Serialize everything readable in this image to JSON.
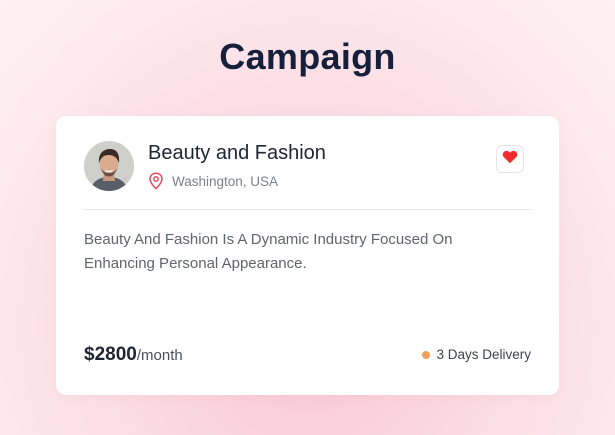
{
  "page": {
    "title": "Campaign"
  },
  "card": {
    "title": "Beauty and Fashion",
    "location": "Washington, USA",
    "description": "Beauty And Fashion Is A Dynamic Industry Focused On Enhancing Personal Appearance.",
    "price_amount": "$2800",
    "price_unit": "/month",
    "delivery": "3 Days Delivery",
    "favorited": true,
    "icons": {
      "avatar": "user-avatar",
      "location": "map-pin-icon",
      "favorite": "heart-icon",
      "status": "status-dot"
    }
  },
  "colors": {
    "title": "#17203a",
    "pin": "#e34a5e",
    "heart": "#ef2b2b",
    "delivery_dot": "#f5a05a",
    "text_muted": "#60646d"
  }
}
